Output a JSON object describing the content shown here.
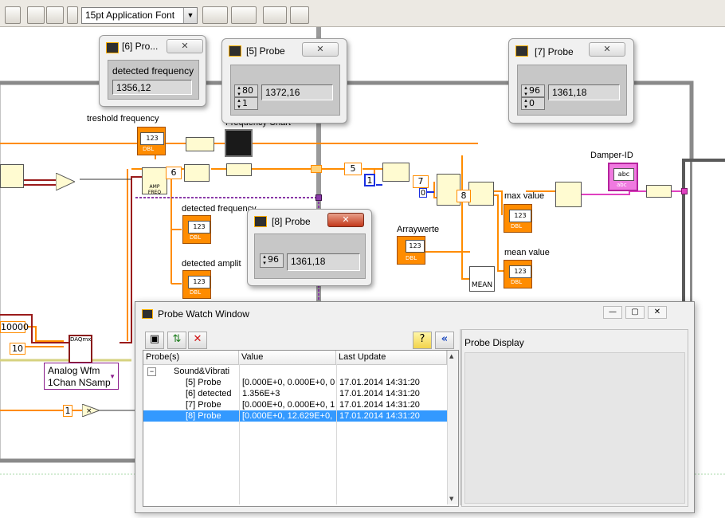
{
  "toolbar": {
    "font_selector": "15pt Application Font"
  },
  "diagram": {
    "labels": {
      "threshold": "treshold frequency",
      "freq_chart": "Frequency Chart",
      "detected_freq": "detected frequency",
      "detected_ampl": "detected amplit",
      "arraywerte": "Arraywerte",
      "damper_id": "Damper-ID",
      "max_value": "max value",
      "mean_value": "mean value",
      "analog_wfm_1": "Analog Wfm",
      "analog_wfm_2": "1Chan NSamp",
      "mean_fn": "MEAN",
      "daq_label": "DAQmx",
      "amp_label": "AMP FREQ",
      "dbl": "DBL",
      "abc": "abc",
      "val_123": "123"
    },
    "constants": {
      "c5": "5",
      "c6": "6",
      "c7": "7",
      "c8": "8",
      "c0": "0",
      "c1_blue": "1",
      "c10": "10",
      "c10000": "10000",
      "c1_mult": "1"
    }
  },
  "probes": {
    "p6": {
      "title": "[6] Pro...",
      "caption": "detected frequency",
      "value": "1356,12"
    },
    "p5": {
      "title": "[5] Probe",
      "idx1": "80",
      "idx2": "1",
      "value": "1372,16"
    },
    "p7": {
      "title": "[7] Probe",
      "idx1": "96",
      "idx2": "0",
      "value": "1361,18"
    },
    "p8": {
      "title": "[8] Probe",
      "idx1": "96",
      "value": "1361,18"
    }
  },
  "watch": {
    "title": "Probe Watch Window",
    "columns": [
      "Probe(s)",
      "Value",
      "Last Update"
    ],
    "group": "Sound&Vibrati",
    "rows": [
      {
        "name": "[5] Probe",
        "value": "[0.000E+0, 0.000E+0, 0",
        "time": "17.01.2014 14:31:20"
      },
      {
        "name": "[6] detected",
        "value": "1.356E+3",
        "time": "17.01.2014 14:31:20"
      },
      {
        "name": "[7] Probe",
        "value": "[0.000E+0, 0.000E+0, 1",
        "time": "17.01.2014 14:31:20"
      },
      {
        "name": "[8] Probe",
        "value": "[0.000E+0, 12.629E+0,",
        "time": "17.01.2014 14:31:20"
      }
    ],
    "display_label": "Probe Display"
  },
  "colors": {
    "orange_wire": "#ff8c00",
    "pink_wire": "#e040c0",
    "blue_wire": "#1a2fe0",
    "probe_red_close": "#c2381a",
    "selection": "#3399ff"
  }
}
